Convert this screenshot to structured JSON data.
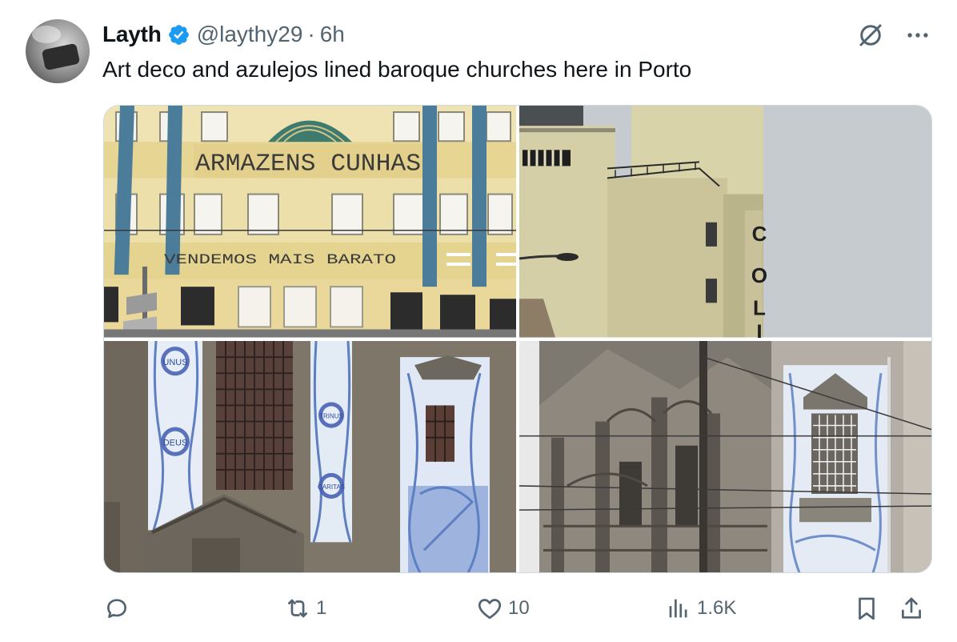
{
  "author": {
    "name": "Layth",
    "handle": "@laythy29",
    "separator": "·",
    "time": "6h",
    "verified_color": "#1d9bf0"
  },
  "tweet": {
    "text": "Art deco and azulejos lined baroque churches here in Porto"
  },
  "photos": [
    {
      "signs": [
        "ARMAZENS CUNHAS",
        "VENDEMOS MAIS BARATO"
      ]
    },
    {
      "signs": [
        "C",
        "O",
        "L",
        "I"
      ]
    },
    {
      "tiles": [
        "UNUS",
        "DEUS",
        "TRINUS",
        "CARITAS"
      ]
    },
    {
      "tiles": []
    }
  ],
  "actions": {
    "reply": {
      "icon": "reply-icon",
      "count": ""
    },
    "repost": {
      "icon": "repost-icon",
      "count": "1"
    },
    "like": {
      "icon": "heart-icon",
      "count": "10"
    },
    "views": {
      "icon": "views-icon",
      "count": "1.6K"
    },
    "bookmark": {
      "icon": "bookmark-icon"
    },
    "share": {
      "icon": "share-icon"
    }
  },
  "colors": {
    "text": "#0f1419",
    "secondary": "#536471",
    "border": "#cfd9de"
  }
}
